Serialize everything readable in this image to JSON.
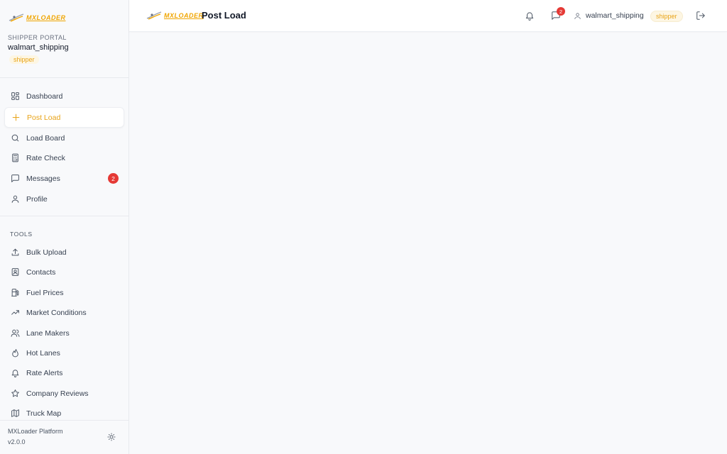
{
  "brand": {
    "logo_text": "MXLOADER",
    "accent": "#e8a317"
  },
  "sidebar": {
    "portal_label": "SHIPPER PORTAL",
    "username": "walmart_shipping",
    "role": "shipper",
    "main_items": [
      {
        "label": "Dashboard",
        "icon": "dashboard-icon"
      },
      {
        "label": "Post Load",
        "icon": "plus-icon",
        "active": true
      },
      {
        "label": "Load Board",
        "icon": "search-icon"
      },
      {
        "label": "Rate Check",
        "icon": "calculator-icon"
      },
      {
        "label": "Messages",
        "icon": "message-icon",
        "badge": "2"
      },
      {
        "label": "Profile",
        "icon": "user-icon"
      }
    ],
    "tools_label": "TOOLS",
    "tool_items": [
      {
        "label": "Bulk Upload",
        "icon": "upload-icon"
      },
      {
        "label": "Contacts",
        "icon": "contacts-icon"
      },
      {
        "label": "Fuel Prices",
        "icon": "fuel-icon"
      },
      {
        "label": "Market Conditions",
        "icon": "trending-up-icon"
      },
      {
        "label": "Lane Makers",
        "icon": "users-icon"
      },
      {
        "label": "Hot Lanes",
        "icon": "flame-icon"
      },
      {
        "label": "Rate Alerts",
        "icon": "bell-icon"
      },
      {
        "label": "Company Reviews",
        "icon": "star-icon"
      },
      {
        "label": "Truck Map",
        "icon": "map-icon"
      }
    ],
    "footer": {
      "platform": "MXLoader Platform",
      "version": "v2.0.0"
    }
  },
  "header": {
    "title": "Post Load",
    "messages_badge": "2",
    "username": "walmart_shipping",
    "role": "shipper"
  }
}
